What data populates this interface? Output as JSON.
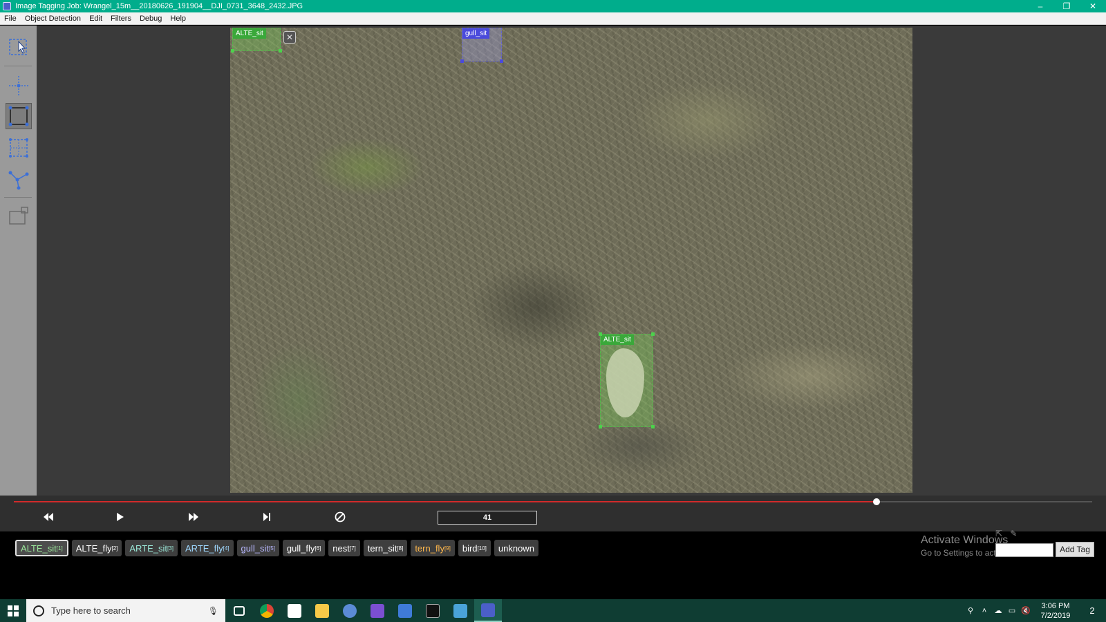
{
  "window": {
    "title": "Image Tagging Job: Wrangel_15m__20180626_191904__DJI_0731_3648_2432.JPG",
    "minimize": "–",
    "restore": "❐",
    "close": "✕"
  },
  "menu": [
    "File",
    "Object Detection",
    "Edit",
    "Filters",
    "Debug",
    "Help"
  ],
  "toolbar": {
    "tools": [
      {
        "name": "select-tool",
        "icon": "pointer-select-icon"
      },
      {
        "name": "point-tool",
        "icon": "point-crosshair-icon"
      },
      {
        "name": "rectangle-tool",
        "icon": "rectangle-icon",
        "active": true
      },
      {
        "name": "copy-rectangle-tool",
        "icon": "grid-rectangle-icon"
      },
      {
        "name": "polygon-tool",
        "icon": "polygon-icon"
      },
      {
        "name": "lock-tool",
        "icon": "lock-rectangle-icon"
      }
    ]
  },
  "regions": [
    {
      "label": "ALTE_sit",
      "color": "green"
    },
    {
      "label": "gull_sit",
      "color": "blue"
    },
    {
      "label": "ALTE_sit",
      "color": "green"
    }
  ],
  "player": {
    "frame": "41",
    "progress_fraction": 0.8,
    "controls": [
      "previous-icon",
      "play-icon",
      "fast-forward-icon",
      "next-frame-icon",
      "clear-icon"
    ]
  },
  "tags": [
    {
      "name": "ALTE_sit",
      "key": "[1]",
      "color": "#9be89b",
      "selected": true
    },
    {
      "name": "ALTE_fly",
      "key": "[2]",
      "color": "#ffffff"
    },
    {
      "name": "ARTE_sit",
      "key": "[3]",
      "color": "#9be8d8"
    },
    {
      "name": "ARTE_fly",
      "key": "[4]",
      "color": "#9fd8ff"
    },
    {
      "name": "gull_sit",
      "key": "[5]",
      "color": "#b8b8ff"
    },
    {
      "name": "gull_fly",
      "key": "[6]",
      "color": "#ffffff"
    },
    {
      "name": "nest",
      "key": "[7]",
      "color": "#ffffff"
    },
    {
      "name": "tern_sit",
      "key": "[8]",
      "color": "#ffffff"
    },
    {
      "name": "tern_fly",
      "key": "[9]",
      "color": "#ffb84d"
    },
    {
      "name": "bird",
      "key": "[10]",
      "color": "#ffffff"
    },
    {
      "name": "unknown",
      "key": "",
      "color": "#ffffff"
    }
  ],
  "add_tag": {
    "button_label": "Add Tag",
    "input_value": ""
  },
  "watermark": {
    "line1": "Activate Windows",
    "line2": "Go to Settings to activate Windows."
  },
  "taskbar": {
    "search_placeholder": "Type here to search",
    "apps": [
      "task-view-icon",
      "chrome-icon",
      "store-icon",
      "file-explorer-icon",
      "r-icon",
      "visual-studio-icon",
      "network-icon",
      "terminal-icon",
      "spreadsheet-icon",
      "tagging-app-icon"
    ],
    "time": "3:06 PM",
    "date": "7/2/2019",
    "notification_count": "2"
  },
  "colors": {
    "titlebar": "#00ad8c",
    "green_box": "#3aa83a",
    "blue_box": "#4a4adc",
    "progress": "#d12a2a"
  }
}
